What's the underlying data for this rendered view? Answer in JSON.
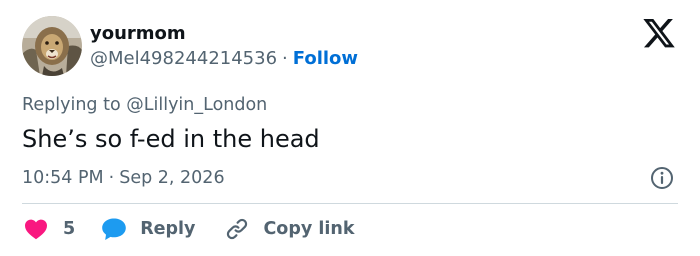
{
  "author": {
    "display_name": "yourmom",
    "handle": "@Mel498244214536",
    "separator": "·",
    "follow_label": "Follow",
    "avatar_icon": "lion-avatar"
  },
  "platform": {
    "logo_icon": "x-logo-icon"
  },
  "reply_context": {
    "prefix": "Replying to ",
    "handle": "@Lillyin_London"
  },
  "tweet": {
    "text": "She’s so f-ed in the head",
    "time": "10:54 PM",
    "separator": "·",
    "date": "Sep 2, 2026"
  },
  "actions": {
    "like_count": "5",
    "reply_label": "Reply",
    "copy_link_label": "Copy link"
  },
  "icons": {
    "like": "heart-icon",
    "reply": "speech-bubble-icon",
    "copy": "link-icon",
    "info": "info-icon"
  },
  "colors": {
    "text_primary": "#0f1419",
    "text_secondary": "#536471",
    "link_blue": "#006fd6",
    "like_pink": "#f91880",
    "reply_blue": "#1d9bf0",
    "divider": "#cfd9de"
  }
}
